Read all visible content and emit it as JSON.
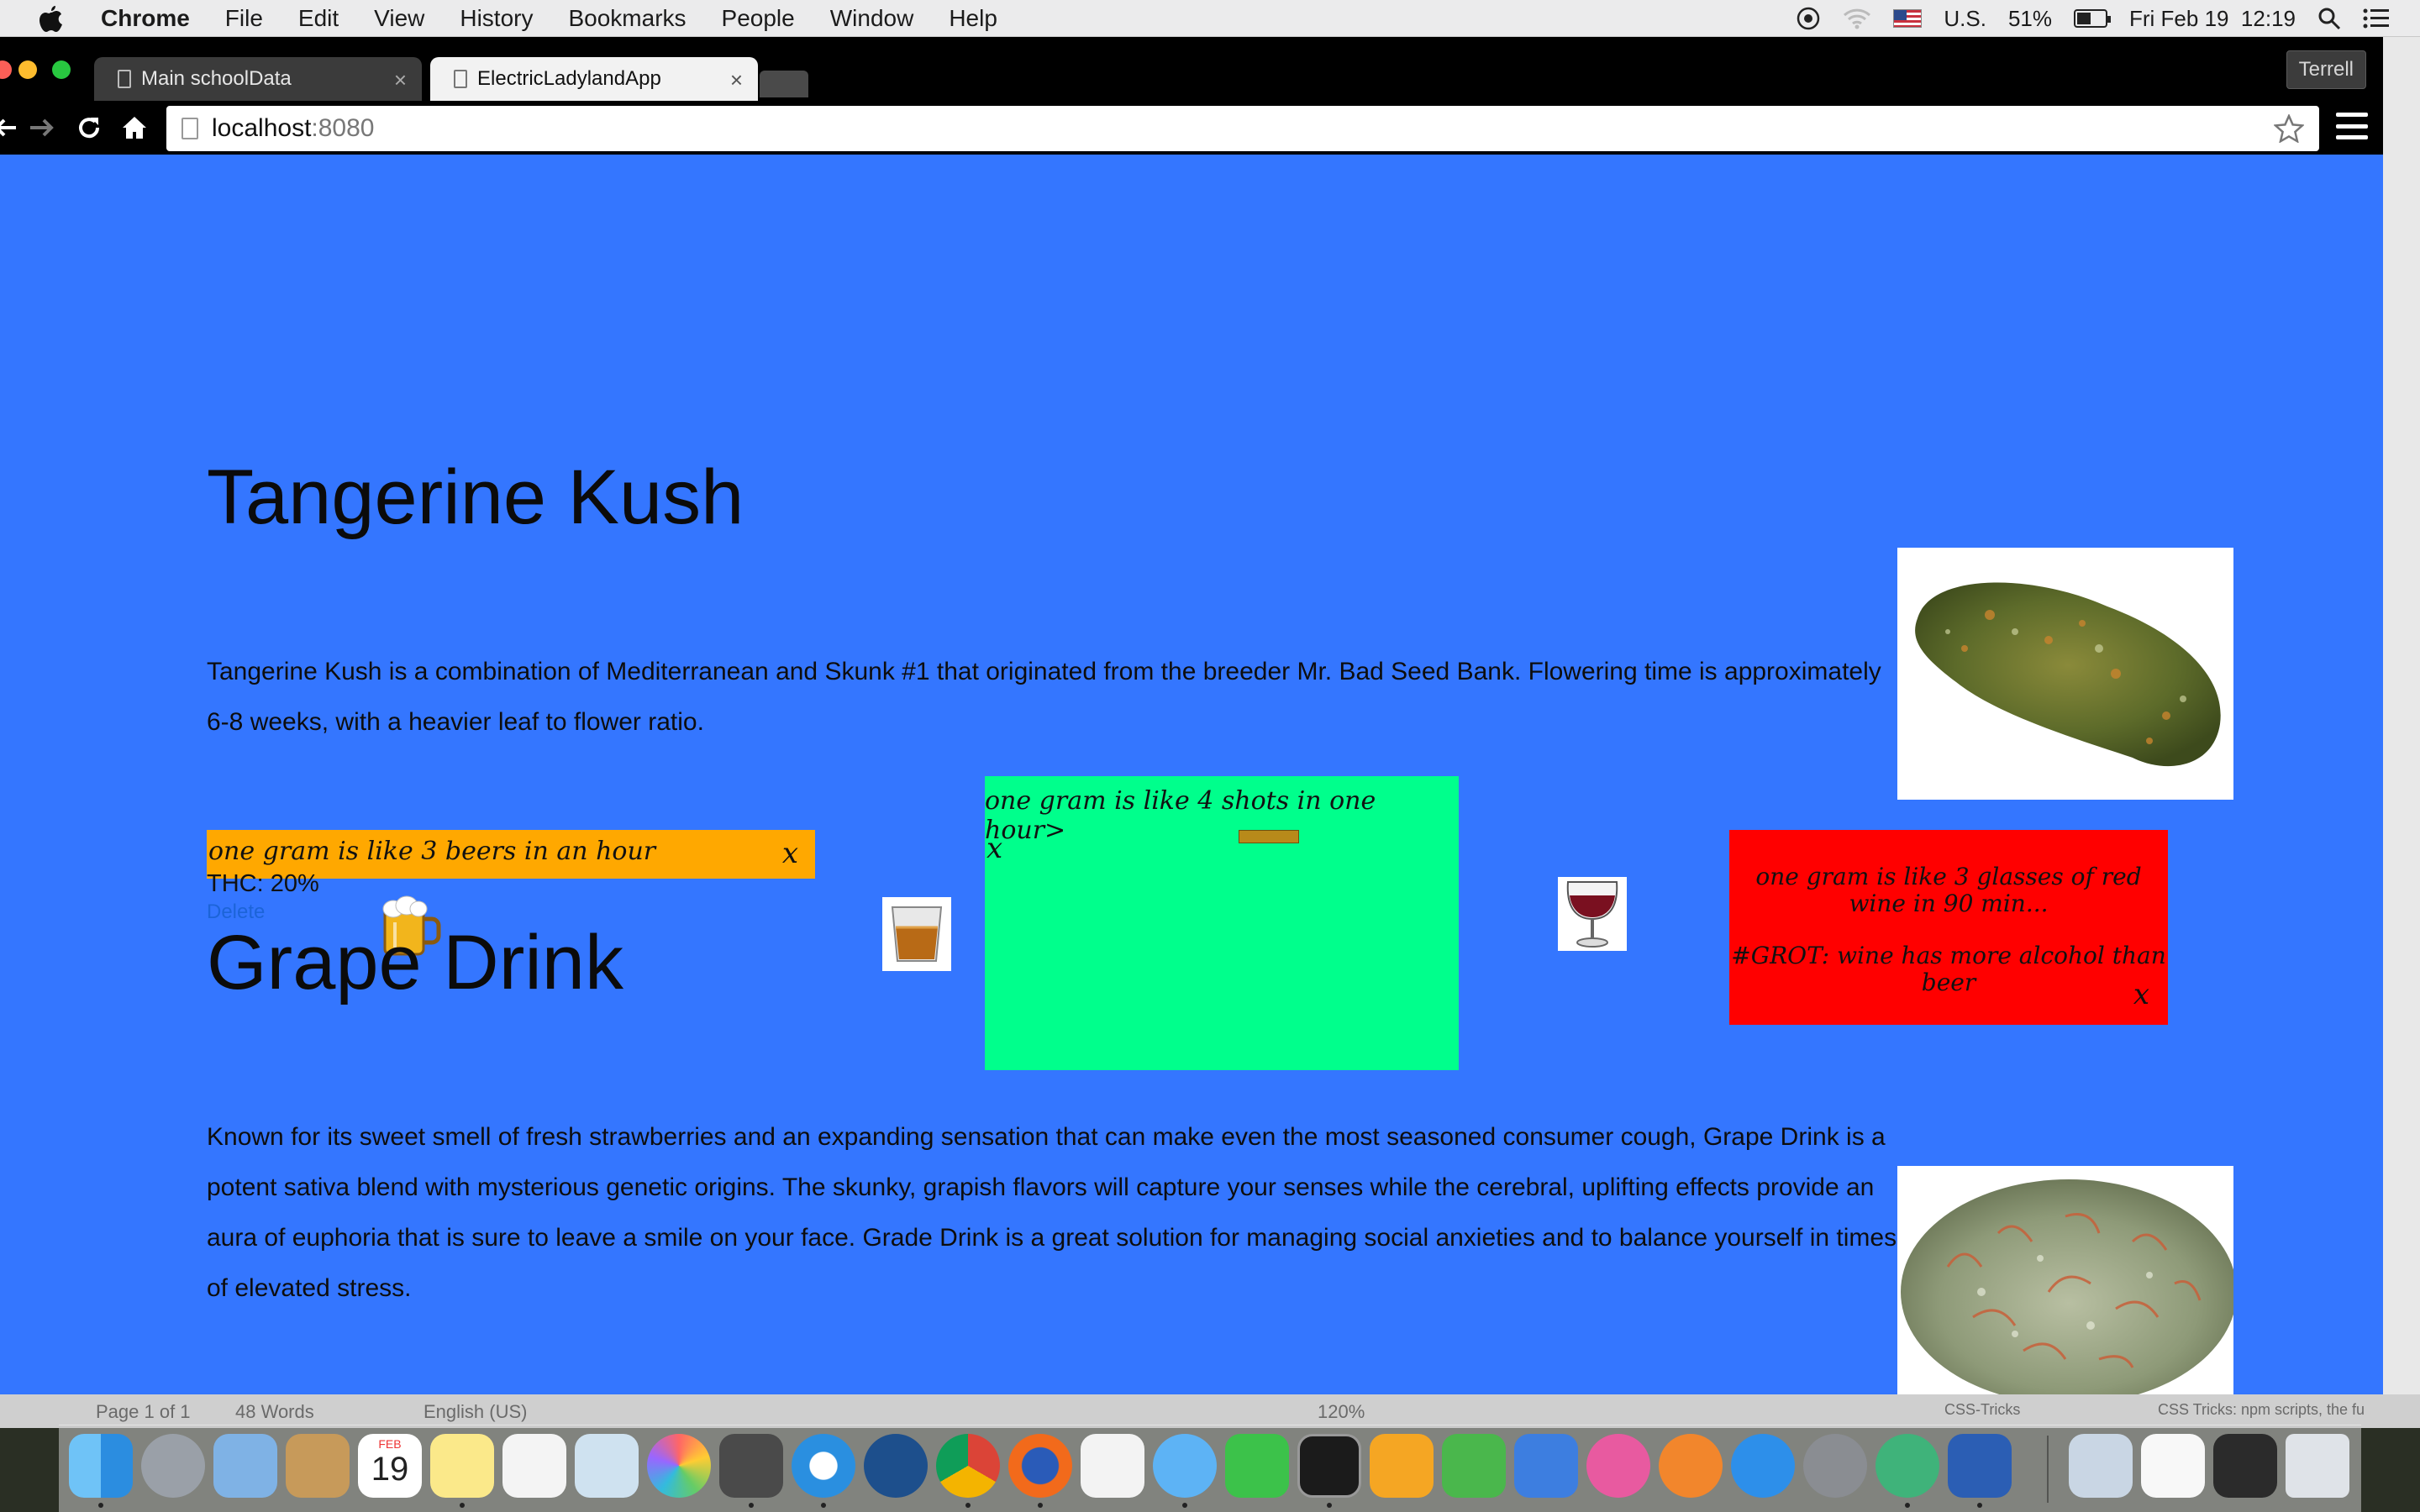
{
  "menubar": {
    "app_name": "Chrome",
    "items": [
      "File",
      "Edit",
      "View",
      "History",
      "Bookmarks",
      "People",
      "Window",
      "Help"
    ],
    "input_source": "U.S.",
    "battery": "51%",
    "battery_level": 0.51,
    "datetime": "Fri Feb 19  12:19"
  },
  "browser": {
    "tabs": [
      {
        "title": "Main schoolData",
        "active": false
      },
      {
        "title": "ElectricLadylandApp",
        "active": true
      }
    ],
    "profile": "Terrell",
    "url_host": "localhost",
    "url_port": ":8080"
  },
  "page": {
    "strains": [
      {
        "name": "Tangerine Kush",
        "description_lines": [
          "Tangerine Kush is a combination of Mediterranean and Skunk #1 that originated from the breeder Mr. Bad Seed Bank. Flowering time is approximately",
          "6-8 weeks, with a heavier leaf to flower ratio."
        ],
        "thc": "THC: 20%",
        "delete_label": "Delete"
      },
      {
        "name": "Grape Drink",
        "description_lines": [
          "Known for its sweet smell of fresh strawberries and an expanding sensation that can make even the most seasoned consumer cough, Grape Drink is a",
          "potent sativa blend with mysterious genetic origins. The skunky, grapish flavors will capture your senses while the cerebral, uplifting effects provide an",
          "aura of euphoria that is sure to leave a smile on your face. Grade Drink is a great solution for managing social anxieties and to balance yourself in times",
          "of elevated stress."
        ]
      }
    ],
    "popups": {
      "beer": {
        "text": "one gram is like 3 beers in an hour",
        "close": "x",
        "color": "#ffa800"
      },
      "shot": {
        "text": "one gram is like 4 shots in one hour>",
        "close": "x",
        "color": "#00ff8c"
      },
      "wine": {
        "text": "one gram is like 3 glasses of red wine in 90 min...",
        "note": "#GROT: wine has more alcohol than beer",
        "close": "x",
        "color": "#ff0000"
      }
    },
    "background_color": "#3476ff"
  },
  "background_apps": {
    "word_status": [
      "Page 1 of 1",
      "48 Words",
      "English (US)",
      "120%"
    ],
    "browser_tabs": [
      "CSS-Tricks",
      "CSS Tricks: npm scripts, the fu"
    ]
  },
  "dock": {
    "icons": [
      "finder-icon",
      "launchpad-icon",
      "mail-icon",
      "contacts-icon",
      "calendar-icon",
      "notes-icon",
      "reminders-icon",
      "preview-icon",
      "photos-icon",
      "sublime-text-icon",
      "safari-icon",
      "quicktime-icon",
      "chrome-icon",
      "firefox-icon",
      "app-grid-icon",
      "messages-icon",
      "facetime-icon",
      "terminal-icon",
      "pages-icon",
      "numbers-icon",
      "keynote-icon",
      "itunes-icon",
      "ibooks-icon",
      "app-store-icon",
      "system-preferences-icon",
      "atom-icon",
      "word-icon",
      "downloads-icon",
      "document-icon",
      "screenshot-icon",
      "trash-icon"
    ],
    "calendar_month": "FEB",
    "calendar_day": "19"
  }
}
